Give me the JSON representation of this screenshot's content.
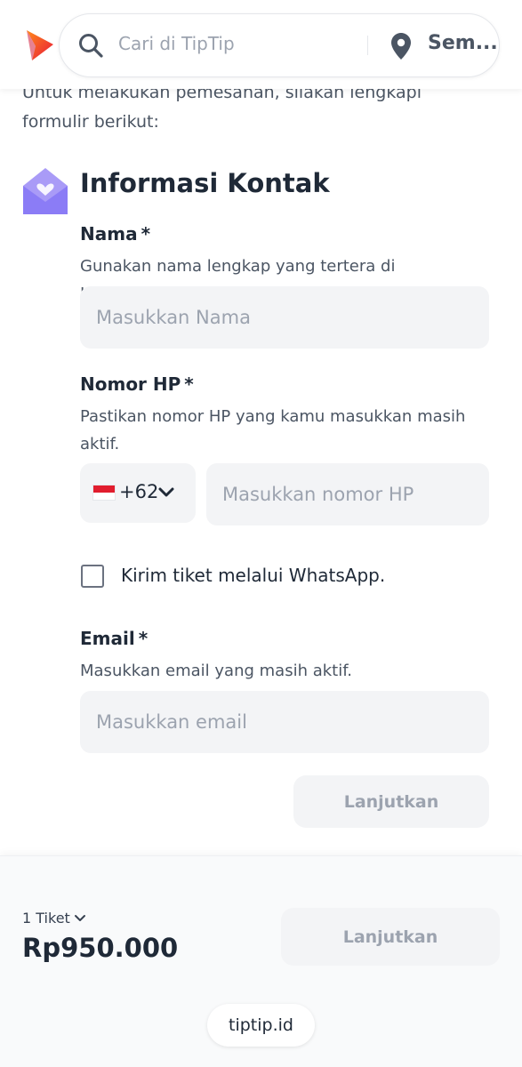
{
  "header": {
    "search_placeholder": "Cari di TipTip",
    "location_label": "Sem..."
  },
  "intro_text": "Untuk melakukan pemesanan, silakan lengkapi formulir berikut:",
  "section": {
    "title": "Informasi Kontak"
  },
  "form": {
    "name": {
      "label": "Nama",
      "required": "*",
      "hint": "Gunakan nama lengkap yang tertera di KTP/Paspor.",
      "placeholder": "Masukkan Nama"
    },
    "phone": {
      "label": "Nomor HP",
      "required": "*",
      "hint": "Pastikan nomor HP yang kamu masukkan masih aktif.",
      "country_code": "+62",
      "placeholder": "Masukkan nomor HP"
    },
    "whatsapp": {
      "label": "Kirim tiket melalui WhatsApp.",
      "checked": false
    },
    "email": {
      "label": "Email",
      "required": "*",
      "hint": "Masukkan email yang masih aktif.",
      "placeholder": "Masukkan email"
    },
    "continue_label": "Lanjutkan"
  },
  "bottom_bar": {
    "quantity": "1 Tiket",
    "price": "Rp950.000",
    "continue_label": "Lanjutkan",
    "domain": "tiptip.id"
  },
  "colors": {
    "brand_orange": "#ff6a13",
    "brand_red": "#e8173a",
    "icon_purple": "#8b7cf6",
    "disabled_bg": "#f3f4f6",
    "disabled_text": "#9ca3af"
  },
  "icons": {
    "logo": "tiptip-logo",
    "search": "search-icon",
    "location": "location-pin-icon",
    "contact": "envelope-icon",
    "dropdown": "chevron-down-icon",
    "flag": "indonesia-flag-icon"
  }
}
